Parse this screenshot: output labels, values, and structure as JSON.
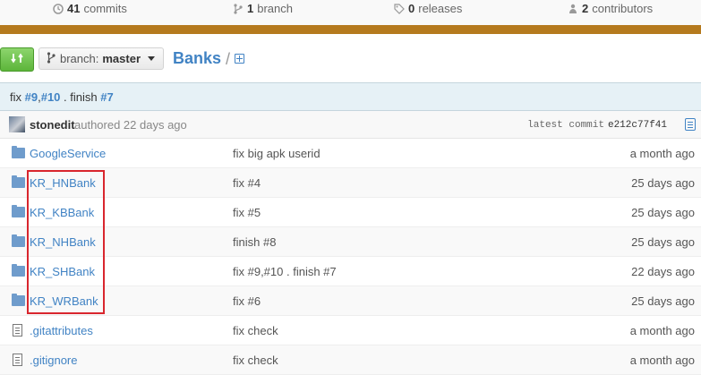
{
  "stats": {
    "commits_count": "41",
    "commits_label": "commits",
    "branch_count": "1",
    "branch_label": "branch",
    "releases_count": "0",
    "releases_label": "releases",
    "contributors_count": "2",
    "contributors_label": "contributors"
  },
  "toolbar": {
    "branch_label": "branch:",
    "branch_value": "master",
    "breadcrumb_repo": "Banks",
    "breadcrumb_sep": "/"
  },
  "commit": {
    "message_prefix": "fix ",
    "ref1": "#9",
    "ref_sep": ",",
    "ref2": "#10",
    "message_mid": " . finish ",
    "ref3": "#7",
    "author": "stonedit",
    "authored": "authored 22 days ago",
    "latest_label": "latest commit",
    "sha": "e212c77f41"
  },
  "files": [
    {
      "type": "folder",
      "name": "GoogleService",
      "message": "fix big apk userid",
      "age": "a month ago"
    },
    {
      "type": "folder",
      "name": "KR_HNBank",
      "message": "fix #4",
      "age": "25 days ago"
    },
    {
      "type": "folder",
      "name": "KR_KBBank",
      "message": "fix #5",
      "age": "25 days ago"
    },
    {
      "type": "folder",
      "name": "KR_NHBank",
      "message": "finish #8",
      "age": "25 days ago"
    },
    {
      "type": "folder",
      "name": "KR_SHBank",
      "message": "fix #9,#10 . finish #7",
      "age": "22 days ago"
    },
    {
      "type": "folder",
      "name": "KR_WRBank",
      "message": "fix #6",
      "age": "25 days ago"
    },
    {
      "type": "file",
      "name": ".gitattributes",
      "message": "fix check",
      "age": "a month ago"
    },
    {
      "type": "file",
      "name": ".gitignore",
      "message": "fix check",
      "age": "a month ago"
    }
  ],
  "colors": {
    "link": "#4183c4",
    "highlight": "#d9262e",
    "stripe": "#b57a1e"
  }
}
